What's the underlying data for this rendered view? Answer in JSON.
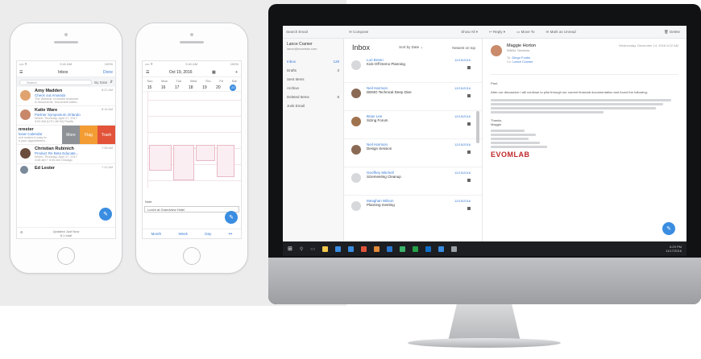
{
  "phone1": {
    "status_left": "•••• ⊽",
    "status_time": "9:41 AM",
    "status_right": "100%",
    "header_title": "Inbox",
    "header_done": "Done",
    "search_placeholder": "Search",
    "sort_label": "By Date",
    "messages": [
      {
        "name": "Amy Madden",
        "subject": "Check out Amanda",
        "preview": "The Webinar of mobile business",
        "preview2": "in documents. Document editin...",
        "time": "8:21 AM",
        "avatar": "#e0a36f"
      },
      {
        "name": "Katie Ware",
        "subject": "Partner Symposium Orlando",
        "preview": "When: Thursday, April 27, 2017",
        "preview2": "9:00 AM (UTC-08:00) Pacific",
        "time": "8:15 AM",
        "avatar": "#c9876a"
      },
      {
        "name": "nrester",
        "subject": "lunar Calendar",
        "preview": "nch makes it easy to",
        "preview2": "n your appointment...",
        "time": "8:00 AM",
        "avatar": "#ffffff"
      },
      {
        "name": "Christian Rubinich",
        "subject": "Product Re Beta Educate...",
        "preview": "When: Thursday, April 27, 2017",
        "preview2": "4:45 am + 5:45 am Chicago",
        "time": "7:38 AM",
        "avatar": "#6a4d3c"
      },
      {
        "name": "Ed Lester",
        "subject": "",
        "preview": "",
        "preview2": "",
        "time": "7:11 AM",
        "avatar": "#7a8a9a"
      }
    ],
    "swipe_more": "More",
    "swipe_flag": "Flag",
    "swipe_trash": "Trash",
    "footer_line1": "Updated Just Now",
    "footer_line2": "8.1 total"
  },
  "phone2": {
    "status_left": "•••• ⊽",
    "status_time": "9:41 AM",
    "status_right": "100%",
    "month_label": "Oct 19, 2016",
    "days": [
      "Sun",
      "Mon",
      "Tue",
      "Wed",
      "Thu",
      "Fri",
      "Sat"
    ],
    "dates": [
      "15",
      "16",
      "17",
      "18",
      "19",
      "20",
      "21"
    ],
    "selected_date": "22",
    "note_label": "Note",
    "note_text": "Lunch at Grandview Hotel",
    "tab_month": "Month",
    "tab_week": "Week",
    "tab_day": "Day",
    "tab_more": "•••"
  },
  "desktop": {
    "search_placeholder": "Search Email",
    "compose_label": "Compose",
    "show_all": "Show All ▾",
    "reply_label": "Reply ▾",
    "move_label": "Move To",
    "mark_unread": "Mark as Unread",
    "delete_label": "Delete",
    "account_name": "Lance Cramer",
    "account_email": "lance@evomlab.com",
    "folders": [
      {
        "name": "Inbox",
        "count": "128"
      },
      {
        "name": "Drafts",
        "count": "3"
      },
      {
        "name": "Sent Items",
        "count": ""
      },
      {
        "name": "Archive",
        "count": ""
      },
      {
        "name": "Deleted Items",
        "count": "8"
      },
      {
        "name": "Junk Email",
        "count": ""
      }
    ],
    "list_title": "Inbox",
    "sort_label": "Sort by Date ⌄",
    "newest_label": "Newest on top",
    "mails": [
      {
        "name": "Lori Breen",
        "subject": "Kick-Off Demo Planning",
        "date": "12/15/2016",
        "avatar": "#d6d8db"
      },
      {
        "name": "Neil Harrison",
        "subject": "DEMO Technical Deep Dive",
        "date": "12/15/2016",
        "avatar": "#8a6a55"
      },
      {
        "name": "Brian Lee",
        "subject": "Sizing Forum",
        "date": "12/15/2016",
        "avatar": "#a0734f"
      },
      {
        "name": "Neil Harrison",
        "subject": "Design Session",
        "date": "12/15/2016",
        "avatar": "#8a6a55"
      },
      {
        "name": "Geoffrey Mitchell",
        "subject": "Sizemeeting Cleanup",
        "date": "12/15/2016",
        "avatar": "#d6d8db"
      },
      {
        "name": "Meaghan Wilson",
        "subject": "Planning meeting",
        "date": "12/15/2016",
        "avatar": "#d6d8db"
      }
    ],
    "reader": {
      "sender": "Maggie Horton",
      "sender_company": "WMAL Services",
      "date": "Wednesday, December 14, 2016 5:22 AM",
      "to_label": "To:",
      "to_value": "Diego Fontin",
      "cc_label": "Cc:",
      "cc_value": "Lance Cramer",
      "greeting": "Paul,",
      "intro": "After our discussion I will continue to pilot through our current financial documentation and found the following:",
      "sign_thanks": "Thanks,",
      "sign_name": "Maggie",
      "company_logo": "EVOMLAB"
    },
    "tray_time": "6:29 PM",
    "tray_date": "11/17/2016"
  },
  "colors": {
    "accent": "#3a8de0",
    "link": "#3a7bd5",
    "swipe_more": "#8e9296",
    "swipe_flag": "#f39c33",
    "swipe_trash": "#e2533a",
    "logo_red": "#c0282a"
  }
}
